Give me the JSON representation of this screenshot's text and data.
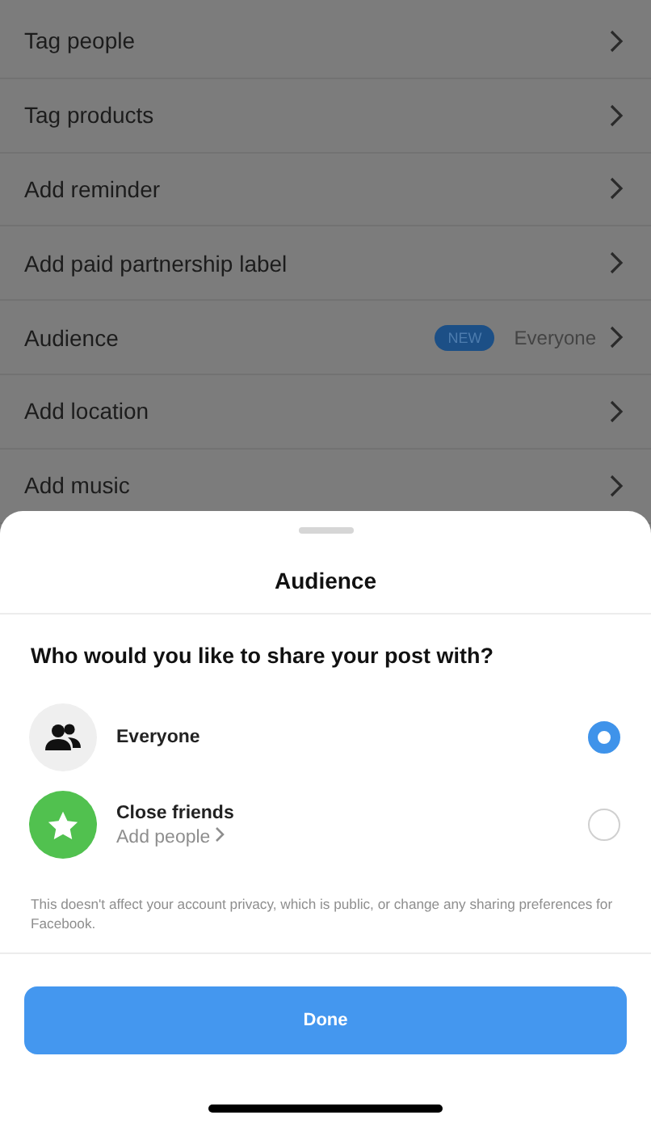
{
  "settings_rows": [
    {
      "label": "Tag people"
    },
    {
      "label": "Tag products"
    },
    {
      "label": "Add reminder"
    },
    {
      "label": "Add paid partnership label"
    },
    {
      "label": "Audience",
      "badge": "NEW",
      "value": "Everyone"
    },
    {
      "label": "Add location"
    },
    {
      "label": "Add music"
    }
  ],
  "sheet": {
    "title": "Audience",
    "question": "Who would you like to share your post with?",
    "options": [
      {
        "kind": "everyone",
        "label": "Everyone",
        "selected": true
      },
      {
        "kind": "close_friends",
        "label": "Close friends",
        "link": "Add people",
        "selected": false
      }
    ],
    "note": "This doesn't affect your account privacy, which is public, or change any sharing preferences for Facebook.",
    "button": "Done"
  }
}
